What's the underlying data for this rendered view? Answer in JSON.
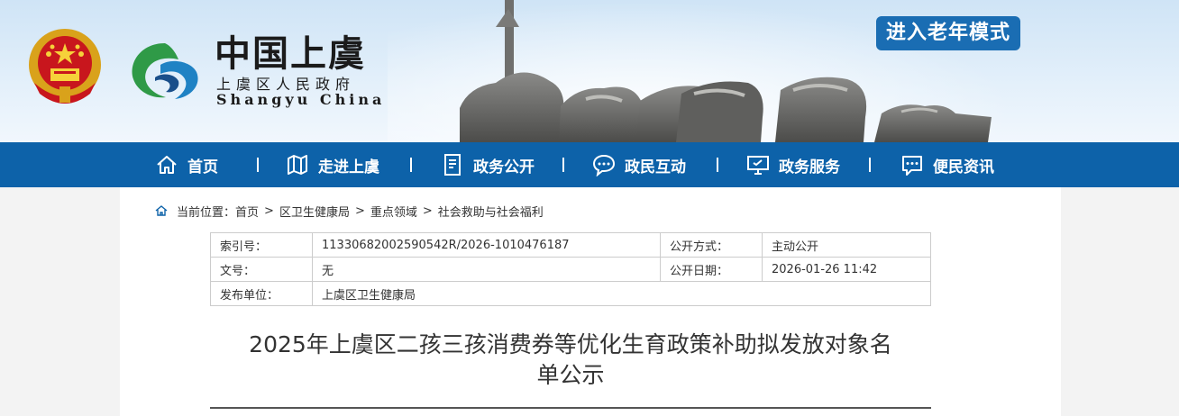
{
  "header": {
    "site_name": "中国上虞",
    "gov_name": "上虞区人民政府",
    "english_name": "Shangyu China",
    "elder_mode_button": "进入老年模式",
    "colors": {
      "brand_blue": "#0d62a9",
      "elder_button": "#1a6db3"
    }
  },
  "nav": {
    "items": [
      {
        "label": "首页",
        "icon": "home-icon"
      },
      {
        "label": "走进上虞",
        "icon": "map-icon"
      },
      {
        "label": "政务公开",
        "icon": "document-icon"
      },
      {
        "label": "政民互动",
        "icon": "chat-icon"
      },
      {
        "label": "政务服务",
        "icon": "monitor-icon"
      },
      {
        "label": "便民资讯",
        "icon": "info-chat-icon"
      }
    ]
  },
  "breadcrumb": {
    "prefix": "当前位置：",
    "items": [
      "首页",
      "区卫生健康局",
      "重点领域",
      "社会救助与社会福利"
    ],
    "separator": ">"
  },
  "meta": {
    "index_label": "索引号：",
    "index_value": "11330682002590542R/2026-1010476187",
    "method_label": "公开方式：",
    "method_value": "主动公开",
    "doc_no_label": "文号：",
    "doc_no_value": "无",
    "date_label": "公开日期：",
    "date_value": "2026-01-26 11:42",
    "publisher_label": "发布单位：",
    "publisher_value": "上虞区卫生健康局"
  },
  "article": {
    "title_line1": "2025年上虞区二孩三孩消费券等优化生育政策补助拟发放对象名",
    "title_line2": "单公示"
  }
}
